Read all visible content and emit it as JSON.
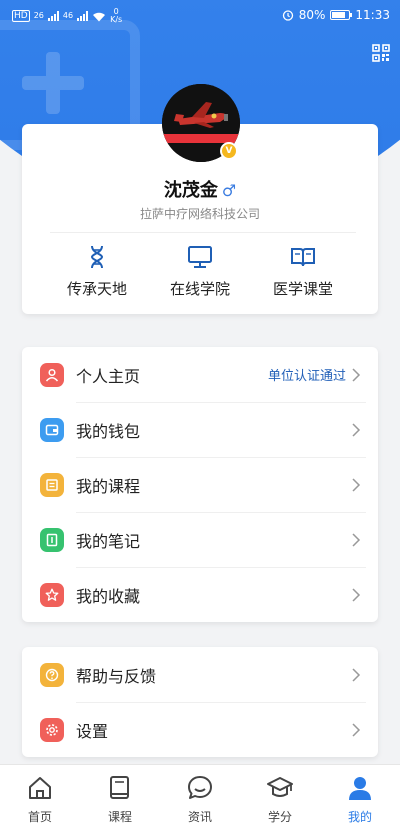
{
  "status_bar": {
    "left_badges": [
      "HD",
      "26",
      "46"
    ],
    "net_speed_value": "0",
    "net_speed_unit": "K/s",
    "battery_level": "80%",
    "time": "11:33"
  },
  "profile": {
    "name": "沈茂金",
    "gender_symbol": "♂",
    "company": "拉萨中疗网络科技公司",
    "badge_letter": "V"
  },
  "quick_links": [
    {
      "label": "传承天地",
      "icon": "dna-icon"
    },
    {
      "label": "在线学院",
      "icon": "monitor-icon"
    },
    {
      "label": "医学课堂",
      "icon": "book-icon"
    }
  ],
  "menu_main": [
    {
      "label": "个人主页",
      "icon": "person-icon",
      "color": "#f0605a",
      "status": "单位认证通过"
    },
    {
      "label": "我的钱包",
      "icon": "wallet-icon",
      "color": "#3d9cf0"
    },
    {
      "label": "我的课程",
      "icon": "course-icon",
      "color": "#f3b33b"
    },
    {
      "label": "我的笔记",
      "icon": "note-icon",
      "color": "#36c26f"
    },
    {
      "label": "我的收藏",
      "icon": "star-icon",
      "color": "#f0605a"
    }
  ],
  "menu_secondary": [
    {
      "label": "帮助与反馈",
      "icon": "help-icon",
      "color": "#f3b33b"
    },
    {
      "label": "设置",
      "icon": "settings-icon",
      "color": "#f0605a"
    }
  ],
  "tabs": [
    {
      "label": "首页",
      "icon": "home-icon"
    },
    {
      "label": "课程",
      "icon": "course-book-icon"
    },
    {
      "label": "资讯",
      "icon": "chat-icon"
    },
    {
      "label": "学分",
      "icon": "graduation-cap-icon"
    },
    {
      "label": "我的",
      "icon": "user-icon",
      "active": true
    }
  ],
  "colors": {
    "brand_blue": "#2e7be8",
    "link_blue": "#2260b8",
    "active_tab": "#2a7be6"
  }
}
